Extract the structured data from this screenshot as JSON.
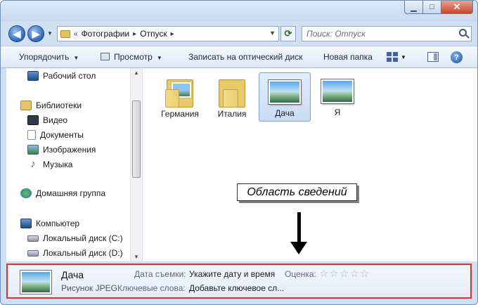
{
  "window": {
    "controls": {
      "minimize": "▁",
      "maximize": "□",
      "close": "✕"
    }
  },
  "address_bar": {
    "prefix": "«",
    "crumbs": [
      "Фотографии",
      "Отпуск"
    ],
    "separator": "▸"
  },
  "search": {
    "placeholder": "Поиск: Отпуск"
  },
  "toolbar": {
    "organize": "Упорядочить",
    "preview": "Просмотр",
    "burn": "Записать на оптический диск",
    "new_folder": "Новая папка",
    "help": "?"
  },
  "sidebar": {
    "desktop": "Рабочий стол",
    "libraries": "Библиотеки",
    "video": "Видео",
    "documents": "Документы",
    "images": "Изображения",
    "music": "Музыка",
    "homegroup": "Домашняя группа",
    "computer": "Компьютер",
    "drive_c": "Локальный диск (C:)",
    "drive_d": "Локальный диск (D:)"
  },
  "files": [
    {
      "name": "Германия",
      "kind": "folder",
      "selected": false
    },
    {
      "name": "Италия",
      "kind": "folder",
      "selected": false
    },
    {
      "name": "Дача",
      "kind": "photo",
      "selected": true
    },
    {
      "name": "Я",
      "kind": "photo",
      "selected": false
    }
  ],
  "annotation": {
    "callout": "Область сведений"
  },
  "details_pane": {
    "name": "Дача",
    "type": "Рисунок JPEG",
    "date_label": "Дата съемки:",
    "date_value": "Укажите дату и время",
    "keywords_label": "Ключевые слова:",
    "keywords_value": "Добавьте ключевое сл...",
    "rating_label": "Оценка:",
    "rating": 0,
    "rating_max": 5,
    "star_glyph": "☆"
  },
  "colors": {
    "accent_border": "#e03030",
    "selection": "#c9dcf5"
  }
}
